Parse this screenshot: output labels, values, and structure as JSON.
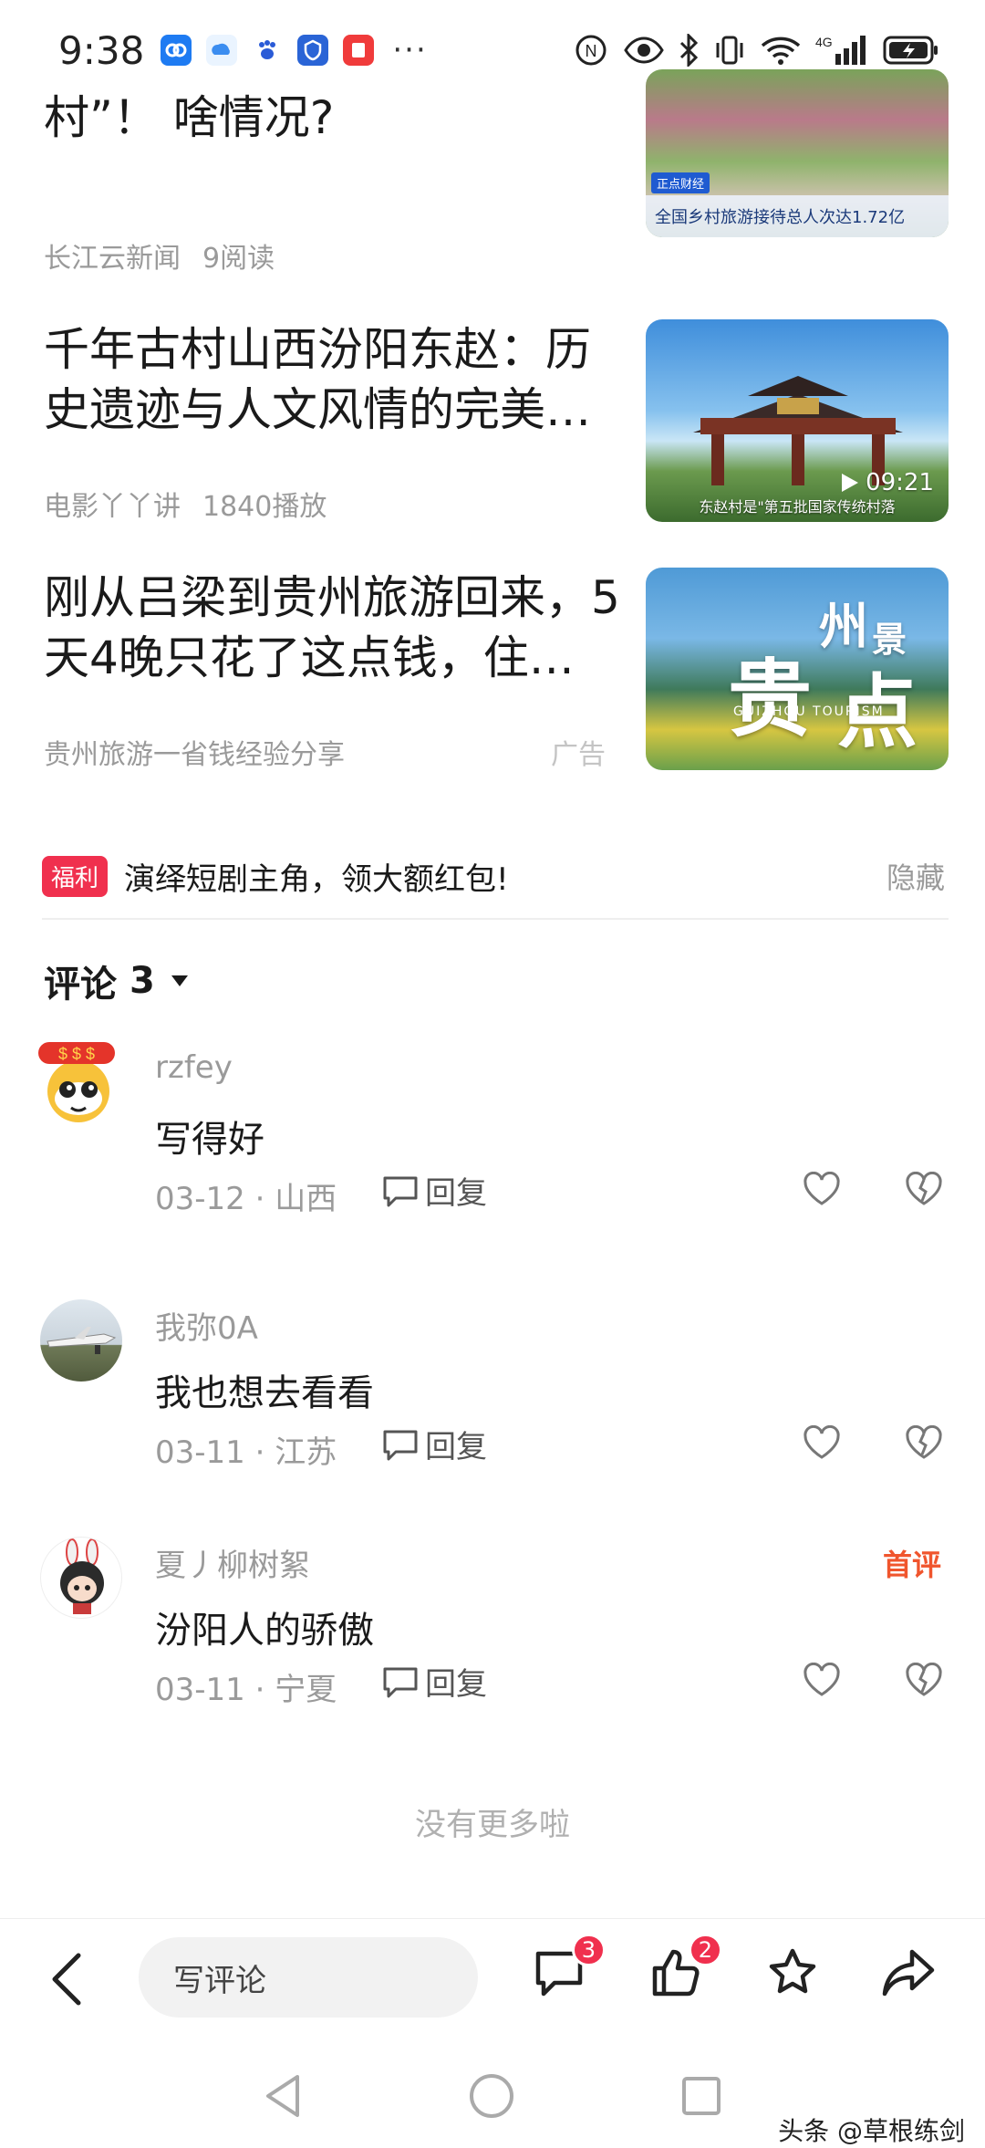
{
  "status_bar": {
    "time": "9:38",
    "apps": [
      "app-blue-icon",
      "app-cloud-icon",
      "app-paw-icon",
      "app-shield-icon",
      "app-red-book-icon"
    ],
    "more": "···",
    "network": "4G"
  },
  "articles": [
    {
      "title_line1": "",
      "title_line2": "村”！ 啥情况?",
      "source": "长江云新闻",
      "stat": "9阅读",
      "thumb_caption": "全国乡村旅游接待总人次达1.72亿",
      "thumb_tag": "正点财经"
    },
    {
      "title": "千年古村山西汾阳东赵：历史遗迹与人文风情的完美…",
      "source": "电影丫丫讲",
      "stat": "1840播放",
      "duration": "09:21",
      "thumb_caption": "东赵村是\"第五批国家传统村落"
    },
    {
      "title": "刚从吕梁到贵州旅游回来，5天4晚只花了这点钱，住…",
      "source": "贵州旅游一省钱经验分享",
      "ad_label": "广告",
      "thumb_text_1": "贵",
      "thumb_text_2": "州",
      "thumb_text_3": "景",
      "thumb_text_4": "点",
      "thumb_sub": "GUIZHOU TOURISM"
    }
  ],
  "promo": {
    "badge": "福利",
    "text": "演绎短剧主角，领大额红包!",
    "hide": "隐藏"
  },
  "comments_header": {
    "label": "评论",
    "count": "3"
  },
  "comments": [
    {
      "user": "rzfey",
      "text": "写得好",
      "meta": "03-12 · 山西",
      "reply": "回复"
    },
    {
      "user": "我弥0A",
      "text": "我也想去看看",
      "meta": "03-11 · 江苏",
      "reply": "回复"
    },
    {
      "user": "夏丿柳树絮",
      "text": "汾阳人的骄傲",
      "meta": "03-11 · 宁夏",
      "reply": "回复",
      "badge": "首评"
    }
  ],
  "no_more": "没有更多啦",
  "action_bar": {
    "write_placeholder": "写评论",
    "comment_count": "3",
    "like_count": "2"
  },
  "watermark": "头条 @草根练剑"
}
